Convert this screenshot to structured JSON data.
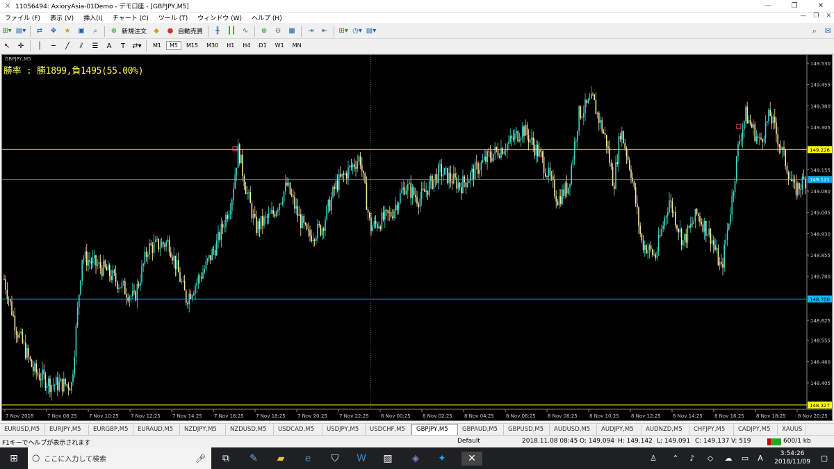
{
  "window": {
    "title": "11056494: AxioryAsia-01Demo - デモ口座 - [GBPJPY,M5]",
    "minimize": "—",
    "maximize": "❐",
    "close": "✕"
  },
  "menu": [
    {
      "label": "ファイル (F)"
    },
    {
      "label": "表示 (V)"
    },
    {
      "label": "挿入(I)"
    },
    {
      "label": "チャート (C)"
    },
    {
      "label": "ツール (T)"
    },
    {
      "label": "ウィンドウ (W)"
    },
    {
      "label": "ヘルプ (H)"
    }
  ],
  "toolbar": {
    "new_order": "新規注文",
    "auto_trade": "自動売買"
  },
  "timeframes": [
    "M1",
    "M5",
    "M15",
    "M30",
    "H1",
    "H4",
    "D1",
    "W1",
    "MN"
  ],
  "selected_timeframe": "M5",
  "chart": {
    "symbol_label": "GBPJPY,M5",
    "winrate_text": "勝率 : 勝1899,負1495(55.00%)",
    "price_labels": [
      "149.530",
      "149.455",
      "149.380",
      "149.305",
      "149.155",
      "149.080",
      "149.005",
      "148.930",
      "148.855",
      "148.780",
      "148.625",
      "148.555",
      "148.480",
      "148.405"
    ],
    "hlines": [
      {
        "price": "149.226",
        "color": "#ffff00"
      },
      {
        "price": "148.700",
        "color": "#00bfff"
      },
      {
        "price": "148.327",
        "color": "#ffff00"
      }
    ],
    "bid_label": "149.121",
    "time_labels": [
      "7 Nov 2018",
      "7 Nov 08:25",
      "7 Nov 10:25",
      "7 Nov 12:25",
      "7 Nov 14:25",
      "7 Nov 16:25",
      "7 Nov 18:25",
      "7 Nov 20:25",
      "7 Nov 22:25",
      "8 Nov 00:25",
      "8 Nov 02:25",
      "8 Nov 04:25",
      "8 Nov 06:25",
      "8 Nov 08:25",
      "8 Nov 10:25",
      "8 Nov 12:25",
      "8 Nov 14:25",
      "8 Nov 16:25",
      "8 Nov 18:25",
      "8 Nov 20:25"
    ],
    "colors": {
      "background": "#000000",
      "bull": "#3fd8c8",
      "bear": "#f5e6a0",
      "bid_line": "#9aa3aa"
    },
    "arrow_markers": [
      {
        "time_index": 5,
        "price": 149.24,
        "color": "#ff4d6a"
      },
      {
        "time_index": 17,
        "price": 149.32,
        "color": "#ff4d6a"
      }
    ],
    "cursor_time_label_index": 8
  },
  "symbol_tabs": [
    "EURUSD,M5",
    "EURJPY,M5",
    "EURGBP,M5",
    "EURAUD,M5",
    "NZDJPY,M5",
    "NZDUSD,M5",
    "USDCAD,M5",
    "USDJPY,M5",
    "USDCHF,M5",
    "GBPJPY,M5",
    "GBPAUD,M5",
    "GBPUSD,M5",
    "AUDUSD,M5",
    "AUDJPY,M5",
    "AUDNZD,M5",
    "CHFJPY,M5",
    "CADJPY,M5",
    "XAUUS"
  ],
  "selected_tab": "GBPJPY,M5",
  "status": {
    "help": "F1キーでヘルプが表示されます",
    "profile": "Default",
    "datetime": "2018.11.08 08:45",
    "open": "O: 149.094",
    "high": "H: 149.142",
    "low": "L: 149.091",
    "close": "C: 149.137",
    "volume": "V: 519",
    "traffic": "600/1 kb"
  },
  "taskbar": {
    "search_placeholder": "ここに入力して検索",
    "time": "3:54:26",
    "date": "2018/11/09",
    "ime": "A"
  }
}
